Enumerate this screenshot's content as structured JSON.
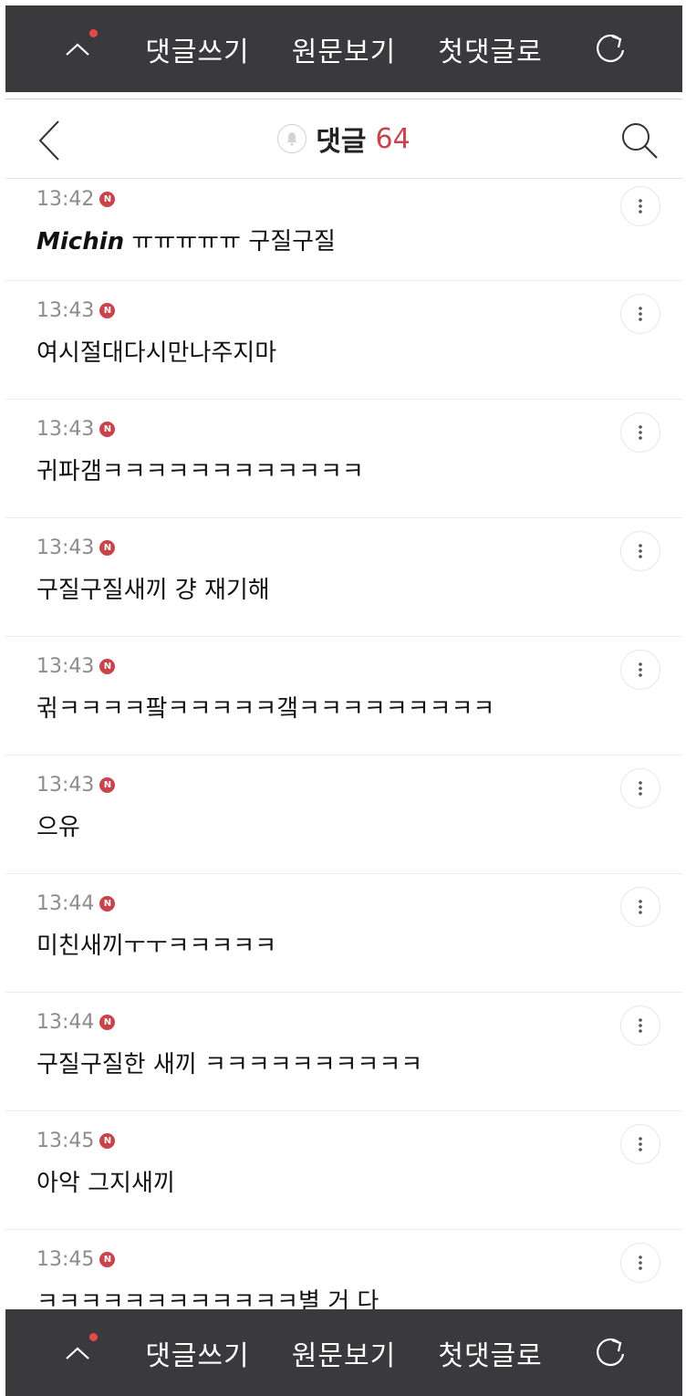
{
  "action_bar": {
    "write_comment": "댓글쓰기",
    "view_original": "원문보기",
    "first_comment": "첫댓글로",
    "icons": {
      "up": "chevron-up-icon",
      "refresh": "refresh-icon"
    },
    "notification_dot_color": "#e64949"
  },
  "header": {
    "title": "댓글",
    "count": "64",
    "count_color": "#c9434b",
    "icons": {
      "back": "back-arrow-icon",
      "bell": "bell-icon",
      "search": "search-icon"
    }
  },
  "badge_label": "N",
  "comments": [
    {
      "time": "13:42",
      "text_em": "Michin",
      "text": " ㅠㅠㅠㅠㅠ 구질구질"
    },
    {
      "time": "13:43",
      "text": "여시절대다시만나주지마"
    },
    {
      "time": "13:43",
      "text": "귀파갬ㅋㅋㅋㅋㅋㅋㅋㅋㅋㅋㅋㅋ"
    },
    {
      "time": "13:43",
      "text": "구질구질새끼 걍 재기해"
    },
    {
      "time": "13:43",
      "text": "귂ㅋㅋㅋㅋ팤ㅋㅋㅋㅋㅋ갴ㅋㅋㅋㅋㅋㅋㅋㅋㅋ"
    },
    {
      "time": "13:43",
      "text": "으유"
    },
    {
      "time": "13:44",
      "text": "미친새끼ㅜㅜㅋㅋㅋㅋㅋ"
    },
    {
      "time": "13:44",
      "text": "구질구질한 새끼 ㅋㅋㅋㅋㅋㅋㅋㅋㅋㅋ"
    },
    {
      "time": "13:45",
      "text": "아악 그지새끼"
    },
    {
      "time": "13:45",
      "text": "ㅋㅋㅋㅋㅋㅋㅋㅋㅋㅋㅋㅋ별 거 다"
    }
  ]
}
